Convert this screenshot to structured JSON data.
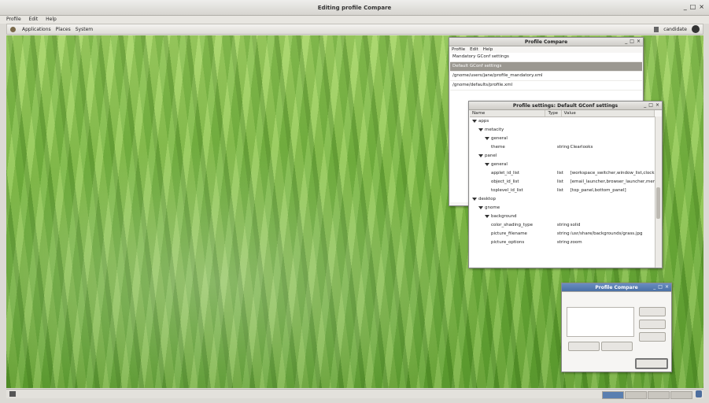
{
  "window": {
    "title": "Editing profile Compare",
    "controls": [
      "_",
      "□",
      "×"
    ]
  },
  "outer_menu": [
    "Profile",
    "Edit",
    "Help"
  ],
  "top_panel": {
    "menus": [
      "Applications",
      "Places",
      "System"
    ],
    "right_user": "candidate"
  },
  "profile_editor": {
    "title": "Profile Compare",
    "menu": [
      "Profile",
      "Edit",
      "Help"
    ],
    "items": [
      "Mandatory GConf settings",
      "Default GConf settings",
      "/gnome/users/jane/profile_mandatory.xml",
      "/gnome/defaults/profile.xml"
    ],
    "selected_index": 1
  },
  "profile_settings": {
    "title": "Profile settings: Default GConf settings",
    "columns": [
      "Name",
      "Type",
      "Value"
    ],
    "rows": [
      {
        "indent": 0,
        "expand": true,
        "name": "apps",
        "type": "",
        "value": ""
      },
      {
        "indent": 1,
        "expand": true,
        "name": "metacity",
        "type": "",
        "value": ""
      },
      {
        "indent": 2,
        "expand": true,
        "name": "general",
        "type": "",
        "value": ""
      },
      {
        "indent": 3,
        "expand": false,
        "name": "theme",
        "type": "string",
        "value": "Clearlooks"
      },
      {
        "indent": 1,
        "expand": true,
        "name": "panel",
        "type": "",
        "value": ""
      },
      {
        "indent": 2,
        "expand": true,
        "name": "general",
        "type": "",
        "value": ""
      },
      {
        "indent": 3,
        "expand": false,
        "name": "applet_id_list",
        "type": "list",
        "value": "[workspace_switcher,window_list,clock]"
      },
      {
        "indent": 3,
        "expand": false,
        "name": "object_id_list",
        "type": "list",
        "value": "[email_launcher,browser_launcher,menu_bar]"
      },
      {
        "indent": 3,
        "expand": false,
        "name": "toplevel_id_list",
        "type": "list",
        "value": "[top_panel,bottom_panel]"
      },
      {
        "indent": 0,
        "expand": true,
        "name": "desktop",
        "type": "",
        "value": ""
      },
      {
        "indent": 1,
        "expand": true,
        "name": "gnome",
        "type": "",
        "value": ""
      },
      {
        "indent": 2,
        "expand": true,
        "name": "background",
        "type": "",
        "value": ""
      },
      {
        "indent": 3,
        "expand": false,
        "name": "color_shading_type",
        "type": "string",
        "value": "solid"
      },
      {
        "indent": 3,
        "expand": false,
        "name": "picture_filename",
        "type": "string",
        "value": "/usr/share/backgrounds/grass.jpg"
      },
      {
        "indent": 3,
        "expand": false,
        "name": "picture_options",
        "type": "string",
        "value": "zoom"
      }
    ]
  },
  "small_dialog": {
    "title": "Profile Compare"
  },
  "colors": {
    "selection": "#9b9891",
    "desktop_top": "#a9d46f",
    "desktop_bottom": "#5e9a35"
  }
}
